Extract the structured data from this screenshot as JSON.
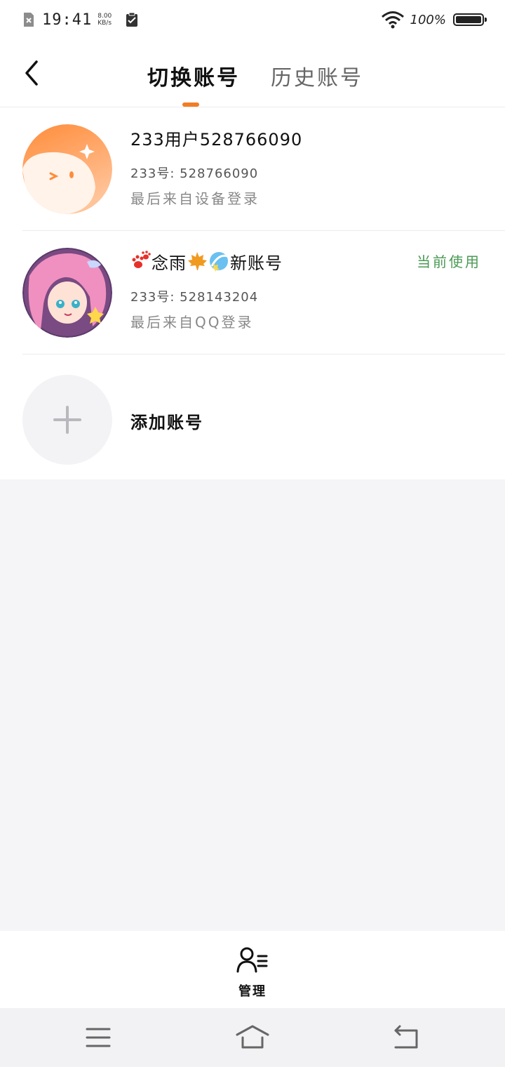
{
  "status_bar": {
    "time": "19:41",
    "speed_value": "8.00",
    "speed_unit": "KB/s",
    "battery_percent": "100%",
    "battery_level": 1.0
  },
  "header": {
    "tabs": [
      {
        "label": "切换账号",
        "active": true
      },
      {
        "label": "历史账号",
        "active": false
      }
    ]
  },
  "accounts": [
    {
      "name": "233用户528766090",
      "id_line": "233号: 528766090",
      "login_source": "最后来自设备登录",
      "current": ""
    },
    {
      "name": "念雨",
      "name_suffix": "新账号",
      "id_line": "233号: 528143204",
      "login_source": "最后来自QQ登录",
      "current": "当前使用"
    }
  ],
  "add_account": {
    "label": "添加账号"
  },
  "bottom_bar": {
    "manage_label": "管理"
  },
  "colors": {
    "accent": "#f07d24",
    "current_green": "#4a9a53",
    "background": "#f5f4f7"
  },
  "icons": [
    "sim-card-icon",
    "clipboard-icon",
    "wifi-icon",
    "battery-icon",
    "back-arrow-icon",
    "plus-icon",
    "manage-user-icon",
    "menu-icon",
    "home-icon",
    "return-icon"
  ]
}
